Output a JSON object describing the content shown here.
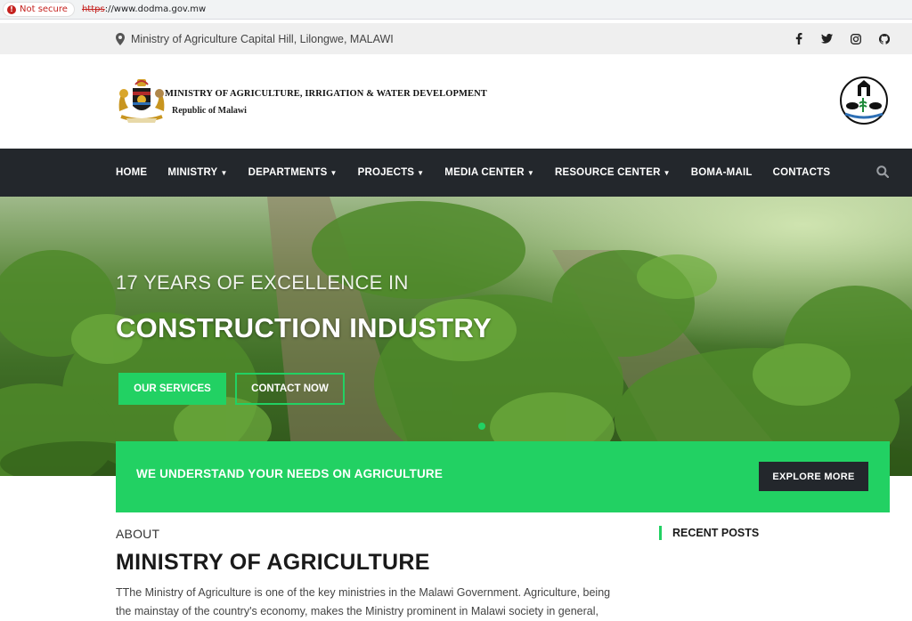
{
  "browser": {
    "security_label": "Not secure",
    "url_scheme": "https",
    "url_rest": "://www.dodma.gov.mw"
  },
  "topbar": {
    "address": "Ministry of Agriculture Capital Hill, Lilongwe, MALAWI",
    "location_icon": "map-marker-icon",
    "socials": [
      "facebook-icon",
      "twitter-icon",
      "instagram-icon",
      "github-icon"
    ]
  },
  "header": {
    "ministry_name": "MINISTRY OF AGRICULTURE, IRRIGATION & WATER DEVELOPMENT",
    "republic": "Republic of Malawi"
  },
  "nav": {
    "items": [
      {
        "label": "HOME",
        "dropdown": false
      },
      {
        "label": "MINISTRY",
        "dropdown": true
      },
      {
        "label": "DEPARTMENTS",
        "dropdown": true
      },
      {
        "label": "PROJECTS",
        "dropdown": true
      },
      {
        "label": "MEDIA CENTER",
        "dropdown": true
      },
      {
        "label": "RESOURCE CENTER",
        "dropdown": true
      },
      {
        "label": "BOMA-MAIL",
        "dropdown": false
      },
      {
        "label": "CONTACTS",
        "dropdown": false
      }
    ],
    "search_icon": "search-icon"
  },
  "hero": {
    "subtitle": "17 YEARS OF EXCELLENCE IN",
    "title": "CONSTRUCTION INDUSTRY",
    "primary_button": "OUR SERVICES",
    "secondary_button": "CONTACT NOW"
  },
  "callout": {
    "text": "WE UNDERSTAND YOUR NEEDS ON AGRICULTURE",
    "button": "EXPLORE MORE"
  },
  "about": {
    "label": "ABOUT",
    "title": "MINISTRY OF AGRICULTURE",
    "body": "TThe Ministry of Agriculture is one of the key ministries in the Malawi Government. Agriculture, being the mainstay of the country's economy, makes the Ministry prominent in Malawi society in general,"
  },
  "sidebar": {
    "recent_posts_title": "RECENT POSTS"
  },
  "colors": {
    "accent_green": "#22d163",
    "dark_nav": "#23272c",
    "topbar_bg": "#efefef"
  }
}
